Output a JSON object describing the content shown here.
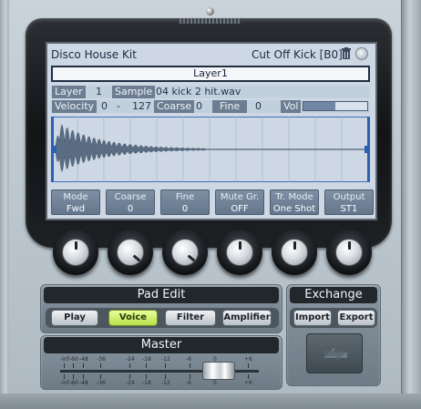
{
  "display": {
    "kit_name": "Disco House Kit",
    "sample_title": "Cut Off Kick [B0]",
    "layer_title": "Layer1",
    "layer_label": "Layer",
    "layer_value": "1",
    "sample_label": "Sample",
    "sample_file": "04 kick 2 hit.wav",
    "velocity_label": "Velocity",
    "velocity_low": "0",
    "velocity_dash": "-",
    "velocity_high": "127",
    "coarse_label": "Coarse",
    "coarse_value": "0",
    "fine_label": "Fine",
    "fine_value": "0",
    "vol_label": "Vol",
    "vol_level": 0.5
  },
  "params": [
    {
      "label": "Mode",
      "value": "Fwd"
    },
    {
      "label": "Coarse",
      "value": "0"
    },
    {
      "label": "Fine",
      "value": "0"
    },
    {
      "label": "Mute Gr.",
      "value": "OFF"
    },
    {
      "label": "Tr. Mode",
      "value": "One Shot"
    },
    {
      "label": "Output",
      "value": "ST1"
    }
  ],
  "pad_edit": {
    "title": "Pad Edit",
    "buttons": [
      {
        "label": "Play",
        "active": false
      },
      {
        "label": "Voice",
        "active": true
      },
      {
        "label": "Filter",
        "active": false
      },
      {
        "label": "Amplifier",
        "active": false
      }
    ]
  },
  "exchange": {
    "title": "Exchange",
    "import_label": "Import",
    "export_label": "Export"
  },
  "master": {
    "title": "Master",
    "scale": [
      "-inf",
      "-60",
      "-48",
      "-36",
      "-24",
      "-18",
      "-12",
      "-6",
      "0",
      "+6"
    ],
    "fader_db": "0"
  },
  "colors": {
    "active_button": "#b8e04a",
    "lcd_bg": "#cdd8e4",
    "wave": "#5a6d82"
  }
}
